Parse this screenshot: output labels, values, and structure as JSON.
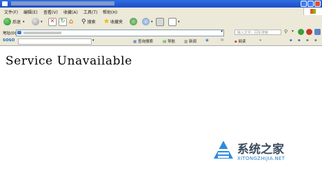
{
  "menubar": {
    "items": [
      "文件(F)",
      "编辑(E)",
      "查看(V)",
      "收藏(A)",
      "工具(T)",
      "帮助(H)"
    ]
  },
  "toolbar": {
    "back_label": "后退",
    "search_label": "搜索",
    "favorites_label": "收藏夹"
  },
  "addressbar": {
    "label": "地址(D)",
    "search_placeholder": "输入文字，回车搜索"
  },
  "linkbar": {
    "logo": "SOSO",
    "items": [
      "查询搜索",
      "导航",
      "新闻",
      "阅读"
    ]
  },
  "content": {
    "message": "Service Unavailable"
  },
  "watermark": {
    "brand": "系统之家",
    "url": "XITONGZHIJIA.NET"
  },
  "colors": {
    "titlebar": "#1b4cc8",
    "chrome": "#ece9d8",
    "watermark_blue": "#2b7ec7"
  }
}
